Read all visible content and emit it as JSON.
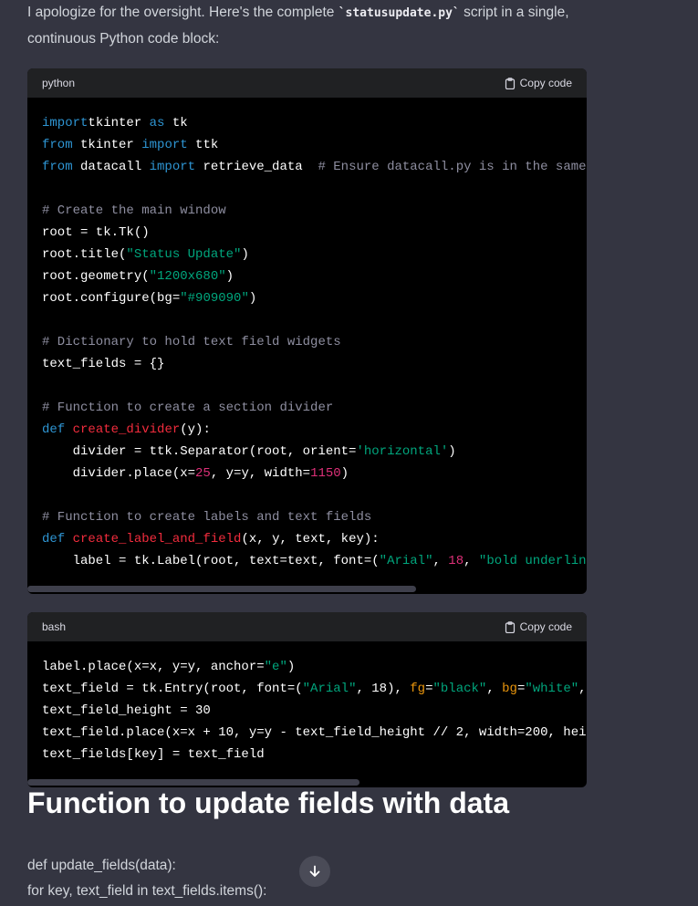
{
  "intro": {
    "before": "I apologize for the oversight. Here's the complete ",
    "code": "`statusupdate.py`",
    "after": " script in a single, continuous Python code block:"
  },
  "blocks": [
    {
      "lang": "python",
      "copy_label": "Copy code",
      "lines": [
        [
          [
            "k",
            "import"
          ],
          [
            "",
            "tkinter "
          ],
          [
            "k",
            "as"
          ],
          [
            "",
            " tk"
          ]
        ],
        [
          [
            "k",
            "from"
          ],
          [
            "",
            " tkinter "
          ],
          [
            "k",
            "import"
          ],
          [
            "",
            " ttk"
          ]
        ],
        [
          [
            "k",
            "from"
          ],
          [
            "",
            " datacall "
          ],
          [
            "k",
            "import"
          ],
          [
            "",
            " retrieve_data  "
          ],
          [
            "c",
            "# Ensure datacall.py is in the same"
          ]
        ],
        [],
        [
          [
            "c",
            "# Create the main window"
          ]
        ],
        [
          [
            "",
            "root = tk.Tk()"
          ]
        ],
        [
          [
            "",
            "root.title("
          ],
          [
            "s",
            "\"Status Update\""
          ],
          [
            "",
            ")"
          ]
        ],
        [
          [
            "",
            "root.geometry("
          ],
          [
            "s",
            "\"1200x680\""
          ],
          [
            "",
            ")"
          ]
        ],
        [
          [
            "",
            "root.configure(bg="
          ],
          [
            "s",
            "\"#909090\""
          ],
          [
            "",
            ")"
          ]
        ],
        [],
        [
          [
            "c",
            "# Dictionary to hold text field widgets"
          ]
        ],
        [
          [
            "",
            "text_fields = {}"
          ]
        ],
        [],
        [
          [
            "c",
            "# Function to create a section divider"
          ]
        ],
        [
          [
            "k",
            "def"
          ],
          [
            "",
            " "
          ],
          [
            "f",
            "create_divider"
          ],
          [
            "",
            "(y):"
          ]
        ],
        [
          [
            "",
            "    divider = ttk.Separator(root, orient="
          ],
          [
            "s",
            "'horizontal'"
          ],
          [
            "",
            ")"
          ]
        ],
        [
          [
            "",
            "    divider.place(x="
          ],
          [
            "n",
            "25"
          ],
          [
            "",
            ", y=y, width="
          ],
          [
            "n",
            "1150"
          ],
          [
            "",
            ")"
          ]
        ],
        [],
        [
          [
            "c",
            "# Function to create labels and text fields"
          ]
        ],
        [
          [
            "k",
            "def"
          ],
          [
            "",
            " "
          ],
          [
            "f",
            "create_label_and_field"
          ],
          [
            "",
            "(x, y, text, key):"
          ]
        ],
        [
          [
            "",
            "    label = tk.Label(root, text=text, font=("
          ],
          [
            "s",
            "\"Arial\""
          ],
          [
            "",
            ", "
          ],
          [
            "n",
            "18"
          ],
          [
            "",
            ", "
          ],
          [
            "s",
            "\"bold underlin"
          ]
        ]
      ]
    },
    {
      "lang": "bash",
      "copy_label": "Copy code",
      "lines": [
        [
          [
            "",
            "label.place(x=x, y=y, anchor="
          ],
          [
            "s",
            "\"e\""
          ],
          [
            "",
            ")"
          ]
        ],
        [
          [
            "",
            "text_field = tk.Entry(root, font=("
          ],
          [
            "s",
            "\"Arial\""
          ],
          [
            "",
            ", 18), "
          ],
          [
            "a",
            "fg"
          ],
          [
            "",
            "="
          ],
          [
            "s",
            "\"black\""
          ],
          [
            "",
            ", "
          ],
          [
            "a",
            "bg"
          ],
          [
            "",
            "="
          ],
          [
            "s",
            "\"white\""
          ],
          [
            "",
            ","
          ]
        ],
        [
          [
            "",
            "text_field_height = 30"
          ]
        ],
        [
          [
            "",
            "text_field.place(x=x + 10, y=y - text_field_height // 2, width=200, hei"
          ]
        ],
        [
          [
            "",
            "text_fields[key] = text_field"
          ]
        ]
      ]
    }
  ],
  "heading": "Function to update fields with data",
  "paragraphs": [
    "def update_fields(data):",
    "for key, text_field in text_fields.items():"
  ],
  "scroll_icon": "arrow-down-icon"
}
